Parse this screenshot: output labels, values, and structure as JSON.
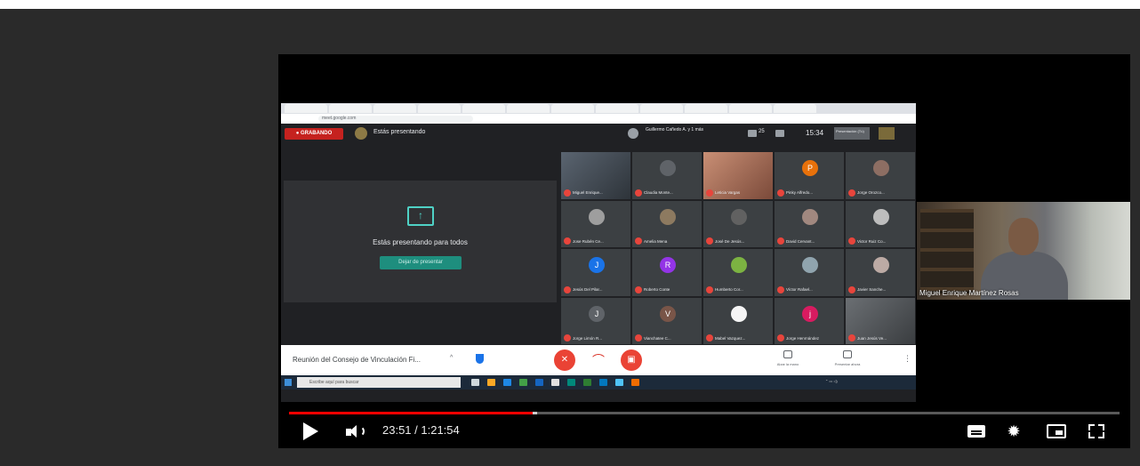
{
  "meet": {
    "recording_label": "● GRABANDO",
    "presenting_label": "Estás presentando",
    "meeting_host_line": "Guillermo Cañedo A. y 1 más",
    "participants_count": "25",
    "clock": "15:34",
    "presenter_chip": "Presentación (Tú)",
    "address_bar": "meet.google.com",
    "share_message": "Estás presentando para todos",
    "stop_presenting_label": "Dejar de presentar",
    "meeting_name": "Reunión del Consejo de Vinculación Fi...",
    "raise_hand_label": "Alzar la mano",
    "present_now_label": "Presentar ahora",
    "taskbar_search": "Escribe aquí para buscar"
  },
  "participants": [
    {
      "name": "Miguel Enrique...",
      "initial": "",
      "color": ""
    },
    {
      "name": "Claudia Monte...",
      "initial": "",
      "color": "#5f6368"
    },
    {
      "name": "Leticia Vargas",
      "initial": "",
      "color": ""
    },
    {
      "name": "Pinky Alfredo...",
      "initial": "P",
      "color": "#e8710a"
    },
    {
      "name": "Jorge Orozco...",
      "initial": "",
      "color": "#8d6e63"
    },
    {
      "name": "Jose Rubén Ce...",
      "initial": "",
      "color": "#9e9e9e"
    },
    {
      "name": "Amelia Mena",
      "initial": "",
      "color": "#8d7a60"
    },
    {
      "name": "José De Jesús...",
      "initial": "",
      "color": "#616161"
    },
    {
      "name": "David Cervant...",
      "initial": "",
      "color": "#a1887f"
    },
    {
      "name": "Victor Ruiz Co...",
      "initial": "",
      "color": "#bdbdbd"
    },
    {
      "name": "Jesús Del Pilar...",
      "initial": "J",
      "color": "#1a73e8"
    },
    {
      "name": "Roberto Conte",
      "initial": "R",
      "color": "#9334e6"
    },
    {
      "name": "Humberto Cor...",
      "initial": "",
      "color": "#7cb342"
    },
    {
      "name": "Víctor Rafael...",
      "initial": "",
      "color": "#90a4ae"
    },
    {
      "name": "Javier Sanche...",
      "initial": "",
      "color": "#bcaaa4"
    },
    {
      "name": "Jorge Limón R...",
      "initial": "J",
      "color": "#5f6368"
    },
    {
      "name": "Vianchatee C...",
      "initial": "V",
      "color": "#795548"
    },
    {
      "name": "Mabel Vazquez...",
      "initial": "",
      "color": "#f5f5f5"
    },
    {
      "name": "Jorge Henrnández",
      "initial": "j",
      "color": "#d81b60"
    },
    {
      "name": "Juan Jesús Ve...",
      "initial": "",
      "color": ""
    }
  ],
  "presenter_camera": {
    "name": "Miguel Enrique Martínez Rosas"
  },
  "player": {
    "time_display": "23:51 / 1:21:54",
    "progress_percent": 29.3,
    "accent": "#ff0000"
  },
  "icons": [
    "play-icon",
    "volume-icon",
    "subtitles-icon",
    "settings-gear-icon",
    "miniplayer-icon",
    "fullscreen-icon"
  ]
}
